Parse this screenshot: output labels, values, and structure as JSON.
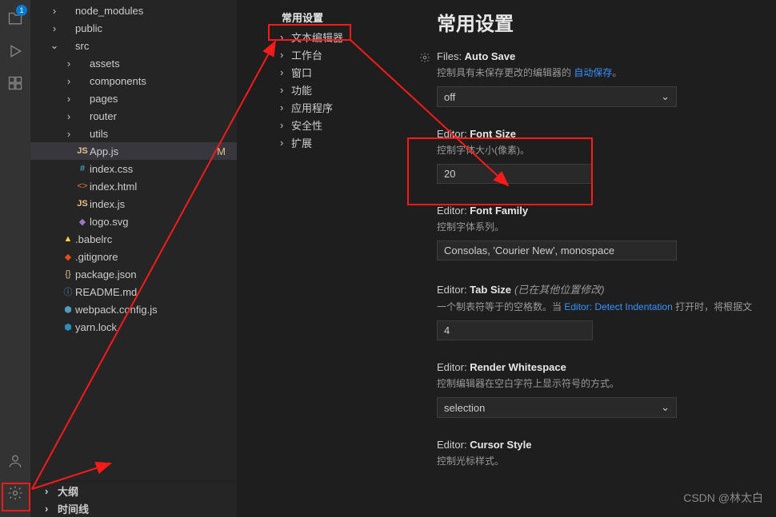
{
  "activity": {
    "badge": "1"
  },
  "explorer": {
    "tree": [
      {
        "label": "node_modules",
        "depth": 1,
        "type": "folder",
        "chev": true
      },
      {
        "label": "public",
        "depth": 1,
        "type": "folder",
        "chev": true
      },
      {
        "label": "src",
        "depth": 1,
        "type": "folder",
        "chev": true,
        "open": true
      },
      {
        "label": "assets",
        "depth": 2,
        "type": "folder",
        "chev": true
      },
      {
        "label": "components",
        "depth": 2,
        "type": "folder",
        "chev": true
      },
      {
        "label": "pages",
        "depth": 2,
        "type": "folder",
        "chev": true
      },
      {
        "label": "router",
        "depth": 2,
        "type": "folder",
        "chev": true
      },
      {
        "label": "utils",
        "depth": 2,
        "type": "folder",
        "chev": true
      },
      {
        "label": "App.js",
        "depth": 2,
        "type": "js",
        "selected": true,
        "mod": "M"
      },
      {
        "label": "index.css",
        "depth": 2,
        "type": "css"
      },
      {
        "label": "index.html",
        "depth": 2,
        "type": "html"
      },
      {
        "label": "index.js",
        "depth": 2,
        "type": "js"
      },
      {
        "label": "logo.svg",
        "depth": 2,
        "type": "svg"
      },
      {
        "label": ".babelrc",
        "depth": 1,
        "type": "babel"
      },
      {
        "label": ".gitignore",
        "depth": 1,
        "type": "git"
      },
      {
        "label": "package.json",
        "depth": 1,
        "type": "json"
      },
      {
        "label": "README.md",
        "depth": 1,
        "type": "md"
      },
      {
        "label": "webpack.config.js",
        "depth": 1,
        "type": "webpack"
      },
      {
        "label": "yarn.lock",
        "depth": 1,
        "type": "yarn"
      }
    ],
    "footer": {
      "outline": "大纲",
      "timeline": "时间线"
    }
  },
  "settingsNav": {
    "title": "常用设置",
    "items": [
      "文本编辑器",
      "工作台",
      "窗口",
      "功能",
      "应用程序",
      "安全性",
      "扩展"
    ]
  },
  "settings": {
    "heading": "常用设置",
    "autoSave": {
      "title_prefix": "Files: ",
      "title_bold": "Auto Save",
      "desc_pre": "控制具有未保存更改的编辑器的 ",
      "desc_link": "自动保存",
      "desc_post": "。",
      "value": "off"
    },
    "fontSize": {
      "title_prefix": "Editor: ",
      "title_bold": "Font Size",
      "desc": "控制字体大小(像素)。",
      "value": "20"
    },
    "fontFamily": {
      "title_prefix": "Editor: ",
      "title_bold": "Font Family",
      "desc": "控制字体系列。",
      "value": "Consolas, 'Courier New', monospace"
    },
    "tabSize": {
      "title_prefix": "Editor: ",
      "title_bold": "Tab Size",
      "override": "(已在其他位置修改)",
      "desc_pre": "一个制表符等于的空格数。当 ",
      "desc_link": "Editor: Detect Indentation",
      "desc_post": " 打开时，将根据文",
      "value": "4"
    },
    "renderWhitespace": {
      "title_prefix": "Editor: ",
      "title_bold": "Render Whitespace",
      "desc": "控制编辑器在空白字符上显示符号的方式。",
      "value": "selection"
    },
    "cursorStyle": {
      "title_prefix": "Editor: ",
      "title_bold": "Cursor Style",
      "desc": "控制光标样式。"
    }
  },
  "watermark": "CSDN @林太白"
}
